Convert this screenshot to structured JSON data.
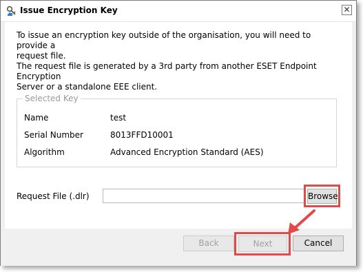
{
  "window": {
    "title": "Issue Encryption Key",
    "close_glyph": "✕"
  },
  "intro": {
    "para1_line1": "To issue an encryption key outside of the organisation, you will need to provide a",
    "para1_line2": "request file.",
    "para2_line1": "The request file is generated by a 3rd party from another ESET Endpoint Encryption",
    "para2_line2": "Server or a standalone EEE client."
  },
  "selected_key": {
    "legend": "Selected Key",
    "rows": [
      {
        "label": "Name",
        "value": "test"
      },
      {
        "label": "Serial Number",
        "value": "8013FFD10001"
      },
      {
        "label": "Algorithm",
        "value": "Advanced Encryption Standard (AES)"
      }
    ]
  },
  "request_file": {
    "label": "Request File (.dlr)",
    "value": "",
    "browse_label": "Browse"
  },
  "footer": {
    "back_label": "Back",
    "next_label": "Next",
    "cancel_label": "Cancel"
  },
  "colors": {
    "highlight": "#e24a4a",
    "disabled_text": "#a0a0a0"
  }
}
